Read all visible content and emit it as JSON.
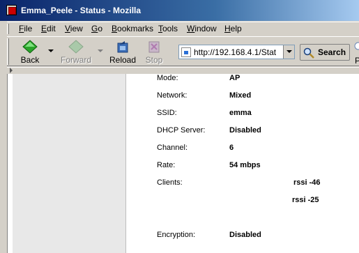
{
  "window": {
    "title": "Emma_Peele - Status - Mozilla"
  },
  "menu": [
    {
      "u": "F",
      "rest": "ile"
    },
    {
      "u": "E",
      "rest": "dit"
    },
    {
      "u": "V",
      "rest": "iew"
    },
    {
      "u": "G",
      "rest": "o"
    },
    {
      "u": "B",
      "rest": "ookmarks"
    },
    {
      "u": "T",
      "rest": "ools"
    },
    {
      "u": "W",
      "rest": "indow"
    },
    {
      "u": "H",
      "rest": "elp"
    }
  ],
  "toolbar": {
    "back": "Back",
    "forward": "Forward",
    "reload": "Reload",
    "stop": "Stop",
    "url": "http://192.168.4.1/Stat",
    "search": "Search",
    "partial": "P"
  },
  "status": {
    "mode": {
      "label": "Mode:",
      "value": "AP"
    },
    "network": {
      "label": "Network:",
      "value": "Mixed"
    },
    "ssid": {
      "label": "SSID:",
      "value": "emma"
    },
    "dhcp": {
      "label": "DHCP Server:",
      "value": "Disabled"
    },
    "channel": {
      "label": "Channel:",
      "value": "6"
    },
    "rate": {
      "label": "Rate:",
      "value": "54 mbps"
    },
    "clients": {
      "label": "Clients:",
      "rssi": [
        "rssi -46",
        "rssi -25"
      ]
    },
    "encryption": {
      "label": "Encryption:",
      "value": "Disabled"
    }
  },
  "colors": {
    "titlebar": "#0a246a",
    "chrome": "#d4d0c8",
    "panel": "#e8e8e8"
  }
}
